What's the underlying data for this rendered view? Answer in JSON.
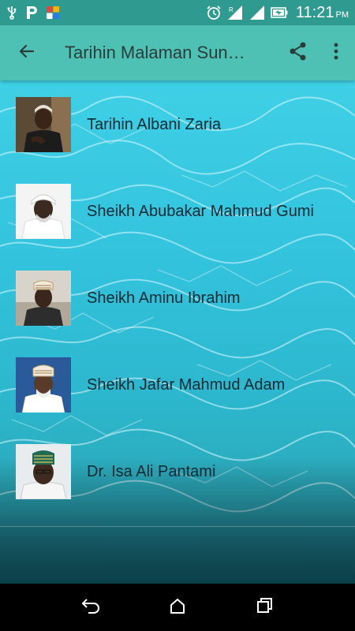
{
  "status_bar": {
    "time": "11:21",
    "ampm": "PM",
    "icons": [
      "usb-icon",
      "p-app-icon",
      "notification-app-icon",
      "alarm-icon",
      "signal-r-icon",
      "signal-icon",
      "battery-icon"
    ]
  },
  "app_bar": {
    "title": "Tarihin Malaman Sunnah",
    "back_icon": "arrow-back-icon",
    "share_icon": "share-icon",
    "menu_icon": "more-vert-icon"
  },
  "list": {
    "items": [
      {
        "label": "Tarihin Albani Zaria",
        "avatar": "portrait-photo"
      },
      {
        "label": "Sheikh Abubakar Mahmud Gumi",
        "avatar": "portrait-photo"
      },
      {
        "label": "Sheikh Aminu Ibrahim",
        "avatar": "portrait-photo"
      },
      {
        "label": "Sheikh Jafar Mahmud Adam",
        "avatar": "portrait-photo"
      },
      {
        "label": "Dr. Isa Ali Pantami",
        "avatar": "portrait-photo"
      }
    ]
  },
  "nav_bar": {
    "icons": [
      "back-nav-icon",
      "home-icon",
      "recents-icon"
    ]
  },
  "colors": {
    "status_bar": "#2f9b90",
    "app_bar": "#4fc1b4",
    "water": "#33c3dd",
    "text": "#0e2a33"
  }
}
